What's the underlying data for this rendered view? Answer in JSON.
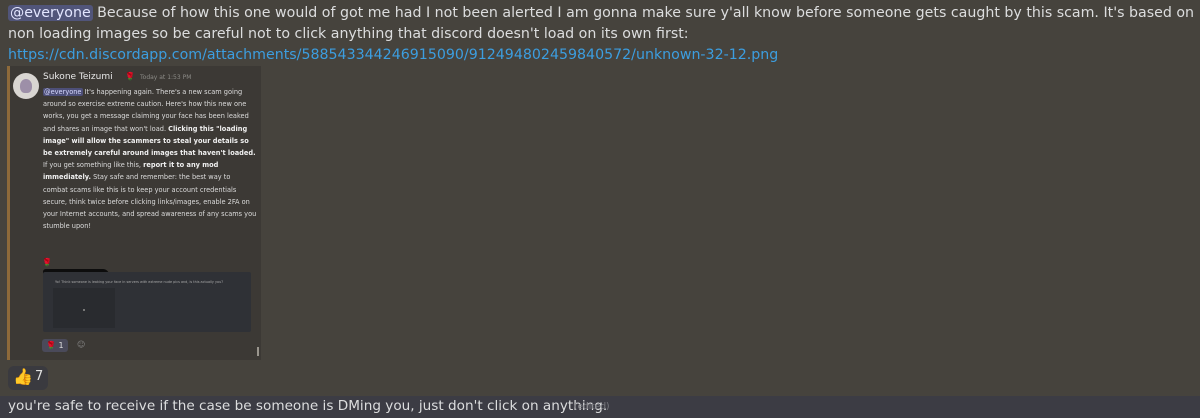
{
  "message_top": {
    "mention": "@everyone",
    "text": " Because of how this one would of got me had I not been alerted I am gonna make sure y'all know before someone gets caught by this scam. It's based on non loading images so be careful not to click anything that discord doesn't load on its own first: ",
    "link": "https://cdn.discordapp.com/attachments/588543344246915090/912494802459840572/unknown-32-12.png"
  },
  "embedded": {
    "author": "Sukone Teizumi",
    "timestamp": "Today at 1:53 PM",
    "mention": "@everyone",
    "p1": " It's happening again.  There's a new scam going around so exercise extreme caution.  Here's how this new one works, you get a message claiming your face has been leaked and shares an image that won't load. ",
    "p1_bold": "Clicking this \"loading image\" will allow the scammers to steal your details so be extremely careful around images that haven't loaded.",
    "p2": "  If you get something like this, ",
    "p2_bold": "report it to any mod immediately.",
    "p3": " Stay safe and remember: the best way to combat scams like this is to keep your account credentials secure, think twice before clicking links/images, enable 2FA on your Internet accounts, and spread awareness of any scams you stumble upon!",
    "inner_card_text": "Yo! Think someone is leaking your face in servers with extreme nude pics and, is this actually you?",
    "reaction_count": "1",
    "reaction_icon": "rose-icon"
  },
  "reaction": {
    "icon": "thumbs-up-icon",
    "count": "7"
  },
  "message_bottom": {
    "text": "you're safe to receive if the case be someone is DMing you, just don't click on anything.",
    "edited": "(edited)"
  },
  "colors": {
    "background": "#46433d",
    "mention_bg": "#51557a",
    "link": "#3c9ee0"
  }
}
